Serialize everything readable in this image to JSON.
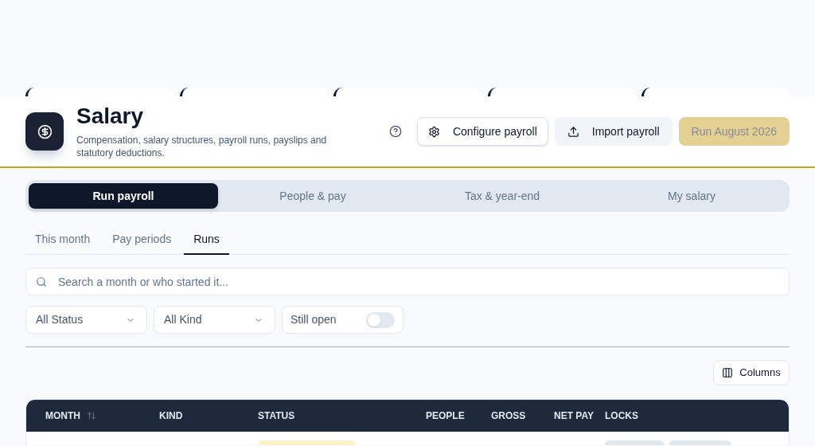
{
  "header": {
    "title": "Salary",
    "subtitle": "Compensation, salary structures, payroll runs, payslips and statutory deductions.",
    "actions": [
      {
        "kind": "outline",
        "label": "Configure payroll",
        "disabled": false
      },
      {
        "kind": "secondary",
        "label": "Import payroll",
        "disabled": false
      },
      {
        "kind": "primary",
        "label": "Run August 2026",
        "disabled": true
      }
    ]
  },
  "tabs": [
    {
      "label": "Run payroll",
      "selected": true
    },
    {
      "label": "People & pay",
      "selected": false
    },
    {
      "label": "Tax & year-end",
      "selected": false
    },
    {
      "label": "My salary",
      "selected": false
    }
  ],
  "subtabs": [
    {
      "label": "This month",
      "selected": false
    },
    {
      "label": "Pay periods",
      "selected": false
    },
    {
      "label": "Runs",
      "selected": true
    }
  ],
  "search": {
    "placeholder": "Search a month or who started it..."
  },
  "filters": [
    {
      "kind": "select",
      "value": "All Status"
    },
    {
      "kind": "select",
      "value": "All Kind"
    },
    {
      "kind": "toggle",
      "label": "Still open",
      "on": false
    }
  ],
  "columns_button": {
    "label": "Columns"
  },
  "table": {
    "columns": [
      {
        "label": "MONTH",
        "sortable": true
      },
      {
        "label": "KIND",
        "sortable": false
      },
      {
        "label": "STATUS",
        "sortable": false
      },
      {
        "label": "PEOPLE",
        "sortable": false
      },
      {
        "label": "GROSS",
        "sortable": false
      },
      {
        "label": "NET PAY",
        "sortable": false
      },
      {
        "label": "LOCKS",
        "sortable": false
      }
    ]
  }
}
